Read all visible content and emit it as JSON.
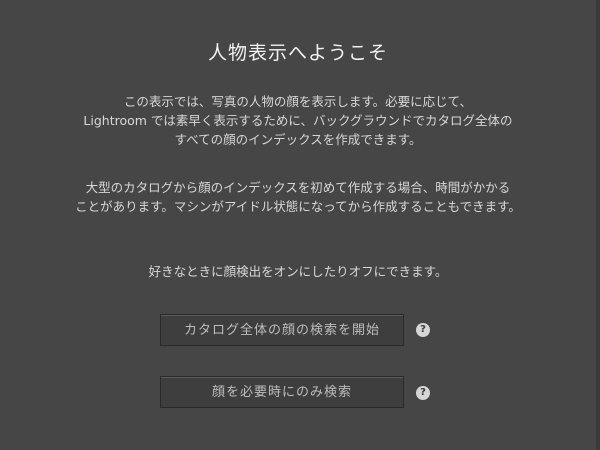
{
  "dialog": {
    "title": "人物表示へようこそ",
    "intro_lines": [
      "この表示では、写真の人物の顔を表示します。必要に応じて、",
      "Lightroom では素早く表示するために、バックグラウンドでカタログ全体の",
      "すべての顔のインデックスを作成できます。"
    ],
    "note_lines": [
      "大型のカタログから顔のインデックスを初めて作成する場合、時間がかかる",
      "ことがあります。マシンがアイドル状態になってから作成することもできます。"
    ],
    "toggle_hint": "好きなときに顔検出をオンにしたりオフにできます。",
    "buttons": {
      "scan_entire_catalog": "カタログ全体の顔の検索を開始",
      "scan_on_demand": "顔を必要時にのみ検索"
    },
    "help_glyph": "?",
    "help_icon": "question-mark-icon"
  },
  "colors": {
    "background": "#464646",
    "button_bg": "#3e3e3e",
    "text": "#d7d7d7",
    "title": "#f2f2f2"
  }
}
